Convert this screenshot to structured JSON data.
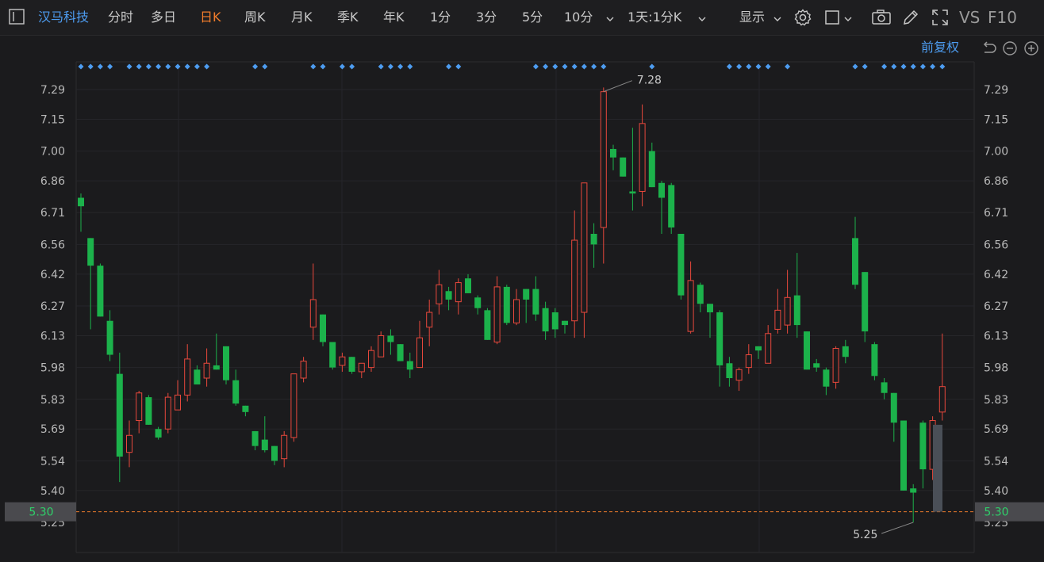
{
  "toolbar": {
    "stock_name": "汉马科技",
    "periods": [
      "分时",
      "多日",
      "日K",
      "周K",
      "月K",
      "季K",
      "年K",
      "1分",
      "3分",
      "5分",
      "10分"
    ],
    "active_period": "日K",
    "range_select": "1天:1分K",
    "display_label": "显示",
    "vs_label": "VS",
    "f10_label": "F10"
  },
  "chart": {
    "price_adjust": "前复权",
    "current_price_label": "5.30",
    "high_marker": "7.28",
    "low_marker": "5.25",
    "y_ticks": [
      "7.29",
      "7.15",
      "7.00",
      "6.86",
      "6.71",
      "6.56",
      "6.42",
      "6.27",
      "6.13",
      "5.98",
      "5.83",
      "5.69",
      "5.54",
      "5.40",
      "5.25"
    ],
    "colors": {
      "up": "#e8483c",
      "down": "#1cb24b",
      "accent": "#f07c2b",
      "blue": "#4d9cf0",
      "bg": "#1b1b1d"
    }
  },
  "chart_data": {
    "type": "candlestick",
    "ylim": [
      5.18,
      7.36
    ],
    "current_price": 5.3,
    "high": 7.28,
    "low": 5.25,
    "candles": [
      [
        6.78,
        6.74,
        6.8,
        6.62
      ],
      [
        6.59,
        6.46,
        6.59,
        6.16
      ],
      [
        6.46,
        6.22,
        6.47,
        6.22
      ],
      [
        6.2,
        6.04,
        6.25,
        6.01
      ],
      [
        5.95,
        5.56,
        6.05,
        5.44
      ],
      [
        5.58,
        5.66,
        5.73,
        5.51
      ],
      [
        5.73,
        5.86,
        5.87,
        5.67
      ],
      [
        5.84,
        5.71,
        5.85,
        5.71
      ],
      [
        5.69,
        5.65,
        5.7,
        5.64
      ],
      [
        5.69,
        5.84,
        5.86,
        5.67
      ],
      [
        5.78,
        5.85,
        5.92,
        5.78
      ],
      [
        5.85,
        6.02,
        6.09,
        5.82
      ],
      [
        5.97,
        5.9,
        5.99,
        5.9
      ],
      [
        5.93,
        6.0,
        6.07,
        5.89
      ],
      [
        5.99,
        5.97,
        6.14,
        5.97
      ],
      [
        6.08,
        5.92,
        6.08,
        5.9
      ],
      [
        5.92,
        5.81,
        5.97,
        5.8
      ],
      [
        5.8,
        5.77,
        5.8,
        5.75
      ],
      [
        5.68,
        5.61,
        5.68,
        5.59
      ],
      [
        5.64,
        5.59,
        5.75,
        5.58
      ],
      [
        5.61,
        5.54,
        5.61,
        5.52
      ],
      [
        5.55,
        5.66,
        5.68,
        5.51
      ],
      [
        5.65,
        5.95,
        5.95,
        5.63
      ],
      [
        5.93,
        6.01,
        6.03,
        5.91
      ],
      [
        6.17,
        6.3,
        6.47,
        6.11
      ],
      [
        6.23,
        6.1,
        6.23,
        6.08
      ],
      [
        6.1,
        5.98,
        6.1,
        5.97
      ],
      [
        5.99,
        6.03,
        6.05,
        5.96
      ],
      [
        6.03,
        5.96,
        6.03,
        5.95
      ],
      [
        5.96,
        6.0,
        6.0,
        5.93
      ],
      [
        5.98,
        6.06,
        6.08,
        5.96
      ],
      [
        6.03,
        6.13,
        6.15,
        6.03
      ],
      [
        6.13,
        6.1,
        6.16,
        6.04
      ],
      [
        6.09,
        6.01,
        6.09,
        6.01
      ],
      [
        6.01,
        5.97,
        6.05,
        5.93
      ],
      [
        5.98,
        6.12,
        6.2,
        5.98
      ],
      [
        6.17,
        6.24,
        6.3,
        6.08
      ],
      [
        6.28,
        6.37,
        6.44,
        6.23
      ],
      [
        6.34,
        6.3,
        6.36,
        6.25
      ],
      [
        6.29,
        6.38,
        6.4,
        6.23
      ],
      [
        6.4,
        6.33,
        6.42,
        6.33
      ],
      [
        6.31,
        6.26,
        6.32,
        6.23
      ],
      [
        6.25,
        6.11,
        6.26,
        6.11
      ],
      [
        6.1,
        6.36,
        6.41,
        6.09
      ],
      [
        6.36,
        6.19,
        6.37,
        6.18
      ],
      [
        6.19,
        6.3,
        6.35,
        6.18
      ],
      [
        6.35,
        6.3,
        6.35,
        6.19
      ],
      [
        6.35,
        6.23,
        6.41,
        6.2
      ],
      [
        6.26,
        6.15,
        6.29,
        6.11
      ],
      [
        6.24,
        6.16,
        6.26,
        6.12
      ],
      [
        6.2,
        6.18,
        6.2,
        6.14
      ],
      [
        6.2,
        6.58,
        6.72,
        6.12
      ],
      [
        6.24,
        6.85,
        6.85,
        6.12
      ],
      [
        6.61,
        6.56,
        6.66,
        6.45
      ],
      [
        6.64,
        7.28,
        7.3,
        6.47
      ],
      [
        7.01,
        6.97,
        7.03,
        6.91
      ],
      [
        6.97,
        6.88,
        6.97,
        6.88
      ],
      [
        6.81,
        6.8,
        7.11,
        6.72
      ],
      [
        6.81,
        7.13,
        7.22,
        6.74
      ],
      [
        7.0,
        6.83,
        7.04,
        6.83
      ],
      [
        6.85,
        6.78,
        6.86,
        6.61
      ],
      [
        6.84,
        6.64,
        6.85,
        6.61
      ],
      [
        6.61,
        6.32,
        6.61,
        6.3
      ],
      [
        6.15,
        6.39,
        6.48,
        6.14
      ],
      [
        6.37,
        6.28,
        6.38,
        6.24
      ],
      [
        6.28,
        6.24,
        6.28,
        6.12
      ],
      [
        6.24,
        5.99,
        6.25,
        5.89
      ],
      [
        6.0,
        5.93,
        6.03,
        5.89
      ],
      [
        5.92,
        5.97,
        5.98,
        5.87
      ],
      [
        5.98,
        6.04,
        6.09,
        5.95
      ],
      [
        6.08,
        6.06,
        6.08,
        6.02
      ],
      [
        6.0,
        6.14,
        6.18,
        6.0
      ],
      [
        6.16,
        6.25,
        6.35,
        6.14
      ],
      [
        6.18,
        6.31,
        6.44,
        6.14
      ],
      [
        6.32,
        6.18,
        6.52,
        6.12
      ],
      [
        6.15,
        5.97,
        6.15,
        5.97
      ],
      [
        6.0,
        5.98,
        6.02,
        5.96
      ],
      [
        5.97,
        5.89,
        5.98,
        5.85
      ],
      [
        5.91,
        6.07,
        6.08,
        5.88
      ],
      [
        6.08,
        6.03,
        6.11,
        6.0
      ],
      [
        6.59,
        6.37,
        6.69,
        6.35
      ],
      [
        6.43,
        6.15,
        6.43,
        6.1
      ],
      [
        6.09,
        5.94,
        6.1,
        5.92
      ],
      [
        5.91,
        5.86,
        5.93,
        5.83
      ],
      [
        5.86,
        5.72,
        5.86,
        5.63
      ],
      [
        5.73,
        5.4,
        5.73,
        5.4
      ],
      [
        5.41,
        5.39,
        5.43,
        5.25
      ],
      [
        5.72,
        5.5,
        5.73,
        5.41
      ],
      [
        5.5,
        5.73,
        5.75,
        5.45
      ],
      [
        5.77,
        5.89,
        6.14,
        5.73
      ]
    ]
  }
}
